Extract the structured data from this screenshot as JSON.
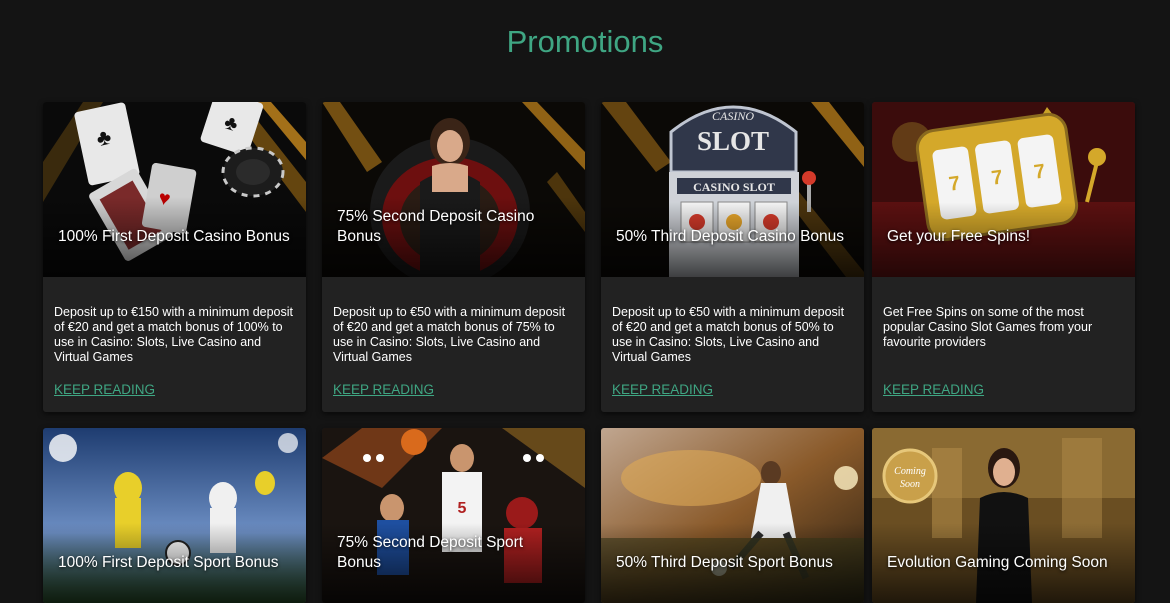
{
  "page": {
    "title": "Promotions"
  },
  "colors": {
    "accent": "#3fa683",
    "background": "#141414",
    "card": "#222222"
  },
  "promotions": [
    {
      "title": "100% First Deposit Casino Bonus",
      "description": "Deposit up to €150 with a minimum deposit of €20 and get a match bonus of 100% to use in Casino: Slots, Live Casino and Virtual Games",
      "link": "KEEP READING",
      "image": "playing-cards-and-chip"
    },
    {
      "title": "75% Second Deposit Casino Bonus",
      "description": "Deposit up to €50 with a minimum deposit of €20 and get a match bonus of 75% to use in Casino: Slots, Live Casino and Virtual Games",
      "link": "KEEP READING",
      "image": "roulette-dealer"
    },
    {
      "title": "50% Third Deposit Casino Bonus",
      "description": "Deposit up to €50 with a minimum deposit of €20 and get a match bonus of 50% to use in Casino: Slots, Live Casino and Virtual Games",
      "link": "KEEP READING",
      "image": "casino-slot-machine",
      "image_text": {
        "top": "CASINO",
        "main": "SLOT",
        "panel": "CASINO SLOT"
      }
    },
    {
      "title": "Get your Free Spins!",
      "description": "Get Free Spins on some of the most popular Casino Slot Games from your favourite providers",
      "link": "KEEP READING",
      "image": "golden-slot-reels"
    },
    {
      "title": "100% First Deposit Sport Bonus",
      "image": "football-players-stadium"
    },
    {
      "title": "75% Second Deposit Sport Bonus",
      "image": "multi-sport-athletes"
    },
    {
      "title": "50% Third Deposit Sport Bonus",
      "image": "football-kick-sunset"
    },
    {
      "title": "Evolution Gaming Coming Soon",
      "image": "live-dealer-coming-soon",
      "image_text": {
        "badge_line1": "Coming",
        "badge_line2": "Soon"
      }
    }
  ]
}
